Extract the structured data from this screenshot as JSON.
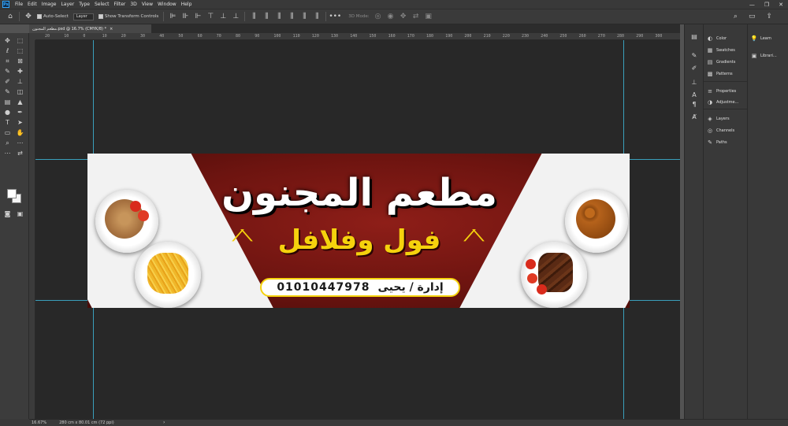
{
  "menubar": {
    "app_logo": "Ps",
    "items": [
      "File",
      "Edit",
      "Image",
      "Layer",
      "Type",
      "Select",
      "Filter",
      "3D",
      "View",
      "Window",
      "Help"
    ],
    "window_controls": [
      "—",
      "❐",
      "✕"
    ]
  },
  "options": {
    "auto_select_label": "Auto-Select",
    "auto_select_value": "Layer",
    "show_transform_label": "Show Transform Controls",
    "mode_3d_label": "3D Mode:"
  },
  "document": {
    "tab_title": "مطعم المجنون.psd @ 16.7% (CMYK/8) *",
    "tab_close": "×"
  },
  "ruler": {
    "top_labels": [
      "20",
      "10",
      "0",
      "10",
      "20",
      "30",
      "40",
      "50",
      "60",
      "70",
      "80",
      "90",
      "100",
      "110",
      "120",
      "130",
      "140",
      "150",
      "160",
      "170",
      "180",
      "190",
      "200",
      "210",
      "220",
      "230",
      "240",
      "250",
      "260",
      "270",
      "280",
      "290",
      "300"
    ]
  },
  "banner": {
    "title": "مطعم المجنون",
    "subtitle": "فول وفلافل",
    "management": "إدارة / يحيى",
    "phone": "01010447978"
  },
  "panels": {
    "mid": [
      {
        "icon": "color-icon",
        "label": "Color"
      },
      {
        "icon": "swatches-icon",
        "label": "Swatches"
      },
      {
        "icon": "gradients-icon",
        "label": "Gradients"
      },
      {
        "icon": "patterns-icon",
        "label": "Patterns"
      },
      {
        "icon": "properties-icon",
        "label": "Properties"
      },
      {
        "icon": "adjustments-icon",
        "label": "Adjustme..."
      },
      {
        "icon": "layers-icon",
        "label": "Layers"
      },
      {
        "icon": "channels-icon",
        "label": "Channels"
      },
      {
        "icon": "paths-icon",
        "label": "Paths"
      }
    ],
    "right": [
      {
        "icon": "learn-icon",
        "label": "Learn"
      },
      {
        "icon": "libraries-icon",
        "label": "Librari..."
      }
    ]
  },
  "status": {
    "zoom": "16.67%",
    "doc_size": "280 cm x 80.01 cm (72 ppi)",
    "chevron": "›"
  },
  "colors": {
    "banner_red": "#7a1712",
    "subtitle_yellow": "#f5d20d",
    "guide_cyan": "#3fbde0",
    "workspace": "#282828"
  }
}
